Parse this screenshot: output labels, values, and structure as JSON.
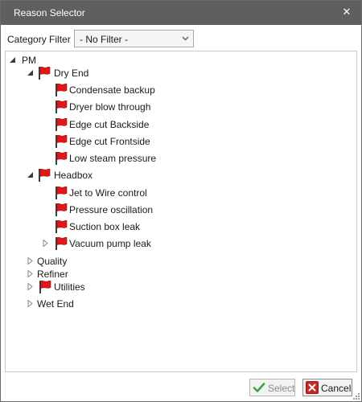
{
  "window": {
    "title": "Reason Selector"
  },
  "filter": {
    "label": "Category Filter",
    "selected": "- No Filter -"
  },
  "tree": {
    "root": "PM",
    "dry_end": {
      "label": "Dry End",
      "children": [
        "Condensate backup",
        "Dryer blow through",
        "Edge cut Backside",
        "Edge cut Frontside",
        "Low steam pressure"
      ]
    },
    "headbox": {
      "label": "Headbox",
      "children": [
        "Jet to Wire control",
        "Pressure oscillation",
        "Suction box leak",
        "Vacuum pump leak"
      ]
    },
    "others": [
      "Quality",
      "Refiner",
      "Utilities",
      "Wet End"
    ]
  },
  "buttons": {
    "select": "Select",
    "cancel": "Cancel"
  },
  "colors": {
    "titlebar": "#5f5f5f",
    "flag": "#e01818",
    "select_check": "#3aa53a",
    "cancel_x": "#c62828"
  }
}
